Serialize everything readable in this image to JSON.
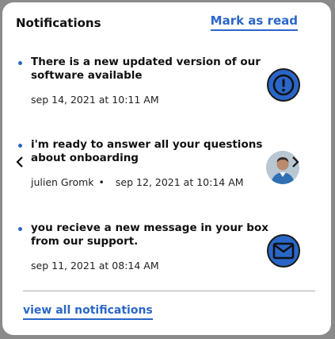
{
  "header": {
    "title": "Notifications",
    "mark_read_label": "Mark as read"
  },
  "notifications": [
    {
      "text": "There is a new updated version of our software available",
      "author": "",
      "date": "sep 14, 2021 at 10:11 AM",
      "icon": "alert-icon",
      "unread": true
    },
    {
      "text": "i'm ready to answer all your questions about onboarding",
      "author": "julien Gromk",
      "separator": "•",
      "date": "sep 12, 2021 at 10:14 AM",
      "icon": "avatar",
      "unread": true
    },
    {
      "text": "you recieve a new message in your box from our support.",
      "author": "",
      "date": "sep 11, 2021 at 08:14 AM",
      "icon": "mail-icon",
      "unread": true
    }
  ],
  "footer": {
    "view_all_label": "view all notifications"
  },
  "colors": {
    "accent": "#2a66c8",
    "text": "#111111",
    "background": "#ffffff"
  }
}
